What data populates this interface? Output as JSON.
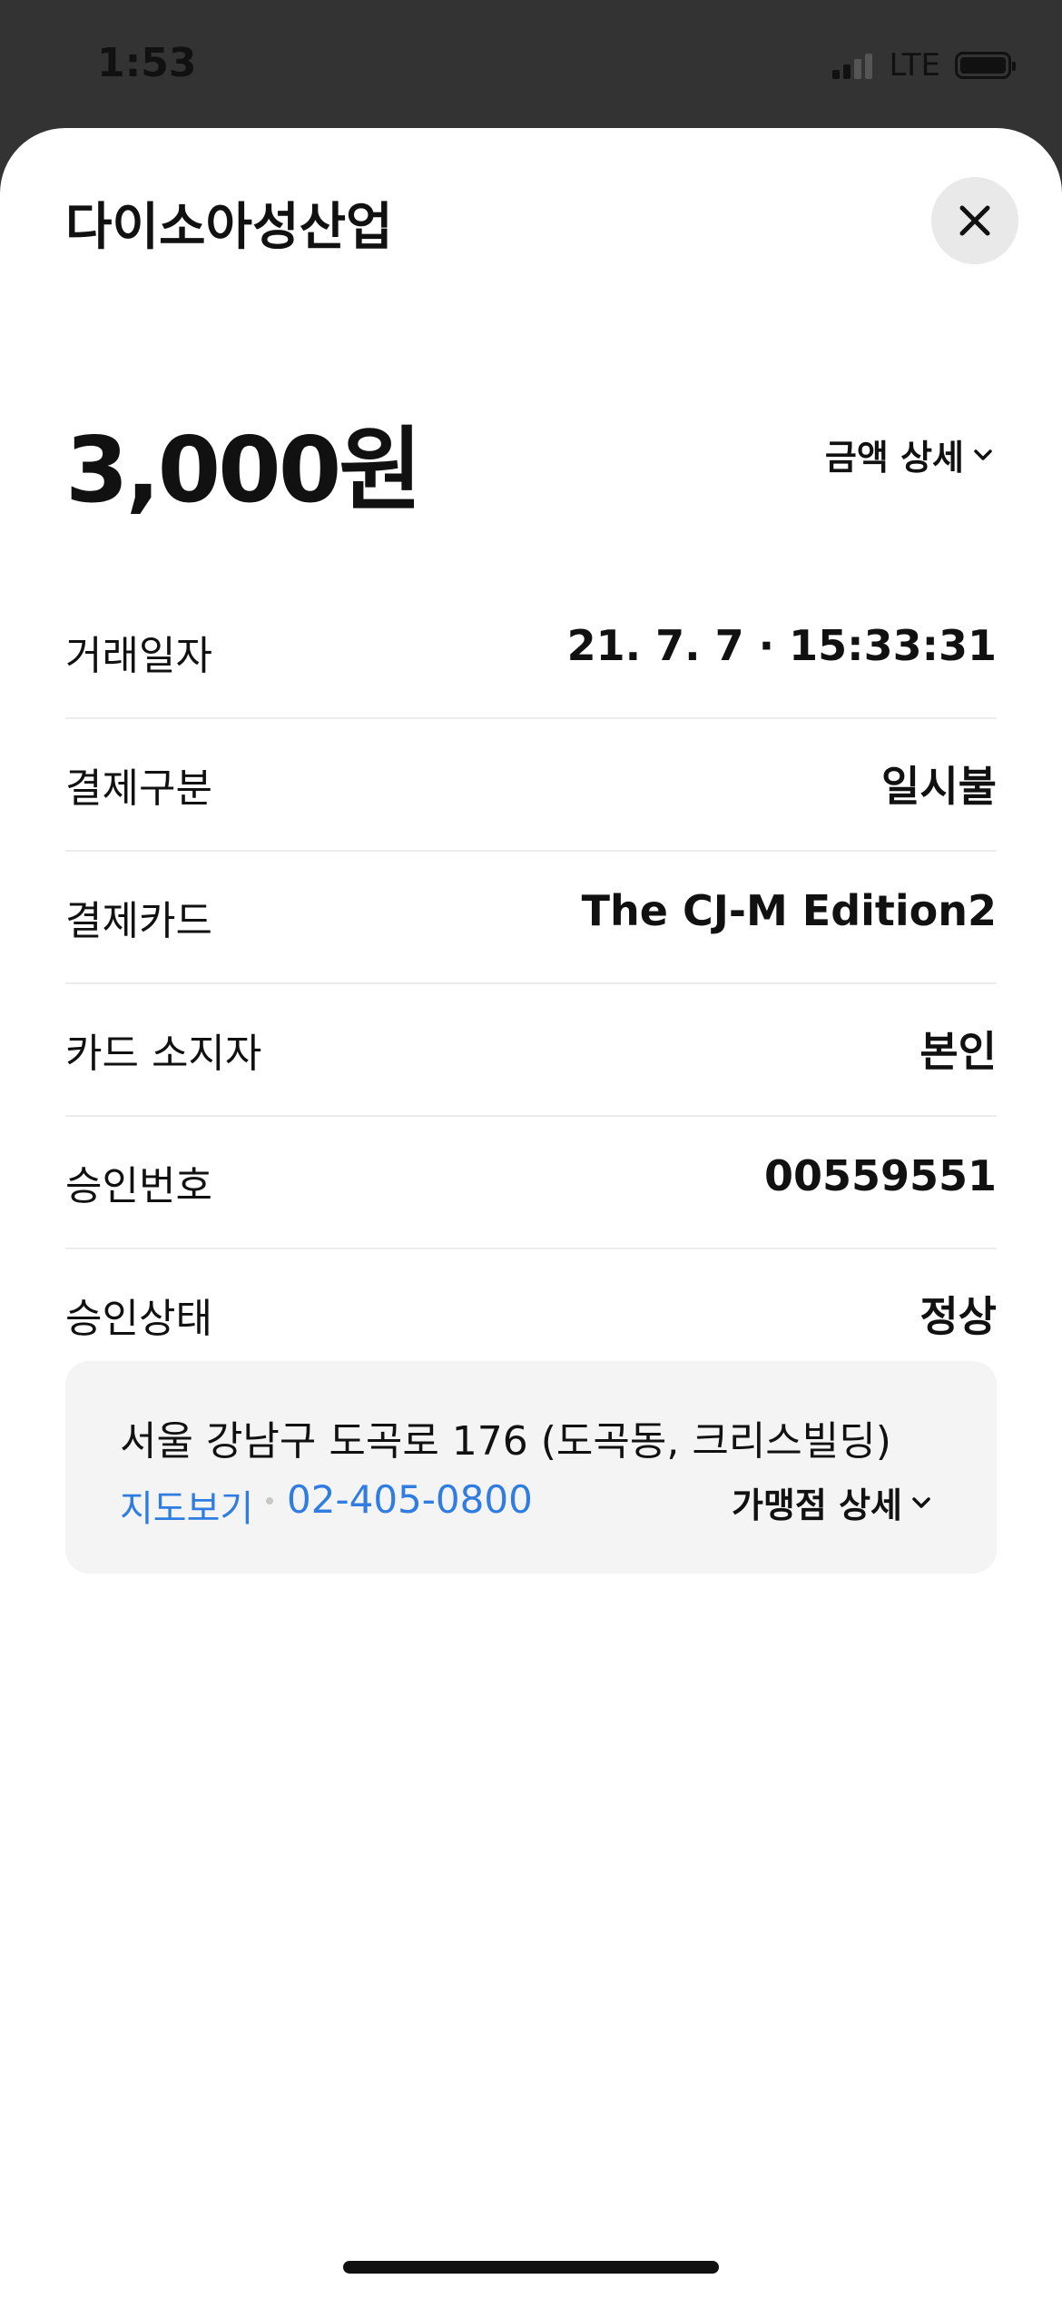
{
  "status_bar": {
    "time": "1:53",
    "network": "LTE"
  },
  "sheet": {
    "merchant_name": "다이소아성산업",
    "close_icon": "close-icon",
    "amount": "3,000원",
    "amount_detail_label": "금액 상세",
    "details": [
      {
        "label": "거래일자",
        "value": "21. 7. 7 · 15:33:31"
      },
      {
        "label": "결제구분",
        "value": "일시불"
      },
      {
        "label": "결제카드",
        "value": "The CJ-M Edition2"
      },
      {
        "label": "카드 소지자",
        "value": "본인"
      },
      {
        "label": "승인번호",
        "value": "00559551"
      },
      {
        "label": "승인상태",
        "value": "정상"
      }
    ],
    "merchant_info": {
      "address": "서울 강남구 도곡로 176 (도곡동, 크리스빌딩)",
      "map_link": "지도보기",
      "phone": "02-405-0800",
      "store_detail_label": "가맹점 상세"
    }
  },
  "colors": {
    "link": "#2f7de1",
    "status_bar_bg": "#333333",
    "sheet_bg": "#ffffff",
    "info_box_bg": "#f4f4f4"
  }
}
